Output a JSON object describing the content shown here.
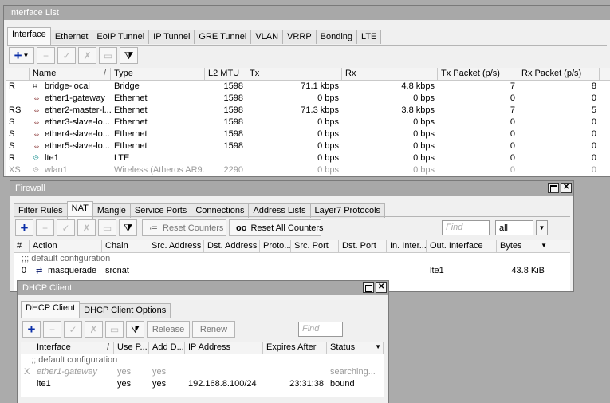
{
  "interface_window": {
    "title": "Interface List",
    "tabs": [
      "Interface",
      "Ethernet",
      "EoIP Tunnel",
      "IP Tunnel",
      "GRE Tunnel",
      "VLAN",
      "VRRP",
      "Bonding",
      "LTE"
    ],
    "columns": [
      "",
      "Name",
      "Type",
      "L2 MTU",
      "Tx",
      "Rx",
      "Tx Packet (p/s)",
      "Rx Packet (p/s)"
    ],
    "rows": [
      {
        "flag": "R",
        "name": "bridge-local",
        "type": "Bridge",
        "mtu": "1598",
        "tx": "71.1 kbps",
        "rx": "4.8 kbps",
        "txp": "7",
        "rxp": "8",
        "icon": "bridge-icon"
      },
      {
        "flag": "",
        "name": "ether1-gateway",
        "type": "Ethernet",
        "mtu": "1598",
        "tx": "0 bps",
        "rx": "0 bps",
        "txp": "0",
        "rxp": "0",
        "icon": "ethernet-icon"
      },
      {
        "flag": "RS",
        "name": "ether2-master-l...",
        "type": "Ethernet",
        "mtu": "1598",
        "tx": "71.3 kbps",
        "rx": "3.8 kbps",
        "txp": "7",
        "rxp": "5",
        "icon": "ethernet-icon"
      },
      {
        "flag": "S",
        "name": "ether3-slave-lo...",
        "type": "Ethernet",
        "mtu": "1598",
        "tx": "0 bps",
        "rx": "0 bps",
        "txp": "0",
        "rxp": "0",
        "icon": "ethernet-icon"
      },
      {
        "flag": "S",
        "name": "ether4-slave-lo...",
        "type": "Ethernet",
        "mtu": "1598",
        "tx": "0 bps",
        "rx": "0 bps",
        "txp": "0",
        "rxp": "0",
        "icon": "ethernet-icon"
      },
      {
        "flag": "S",
        "name": "ether5-slave-lo...",
        "type": "Ethernet",
        "mtu": "1598",
        "tx": "0 bps",
        "rx": "0 bps",
        "txp": "0",
        "rxp": "0",
        "icon": "ethernet-icon"
      },
      {
        "flag": "R",
        "name": "lte1",
        "type": "LTE",
        "mtu": "",
        "tx": "0 bps",
        "rx": "0 bps",
        "txp": "0",
        "rxp": "0",
        "icon": "lte-icon"
      },
      {
        "flag": "XS",
        "name": "wlan1",
        "type": "Wireless (Atheros AR9...",
        "mtu": "2290",
        "tx": "0 bps",
        "rx": "0 bps",
        "txp": "0",
        "rxp": "0",
        "icon": "wireless-icon",
        "disabled": true
      }
    ]
  },
  "firewall_window": {
    "title": "Firewall",
    "tabs": [
      "Filter Rules",
      "NAT",
      "Mangle",
      "Service Ports",
      "Connections",
      "Address Lists",
      "Layer7 Protocols"
    ],
    "reset_counters": "Reset Counters",
    "reset_all_counters": "Reset All Counters",
    "reset_all_prefix": "oo",
    "find_placeholder": "Find",
    "filter_value": "all",
    "columns": [
      "#",
      "Action",
      "Chain",
      "Src. Address",
      "Dst. Address",
      "Proto...",
      "Src. Port",
      "Dst. Port",
      "In. Inter...",
      "Out. Interface",
      "Bytes"
    ],
    "comment": ";;; default configuration",
    "rows": [
      {
        "num": "0",
        "action": "masquerade",
        "chain": "srcnat",
        "out_interface": "lte1",
        "bytes": "43.8 KiB"
      }
    ]
  },
  "dhcp_window": {
    "title": "DHCP Client",
    "tabs": [
      "DHCP Client",
      "DHCP Client Options"
    ],
    "release": "Release",
    "renew": "Renew",
    "find_placeholder": "Find",
    "columns": [
      "",
      "Interface",
      "Use P...",
      "Add D...",
      "IP Address",
      "Expires After",
      "Status"
    ],
    "comment": ";;; default configuration",
    "rows": [
      {
        "flag": "X",
        "interface": "ether1-gateway",
        "use_peer": "yes",
        "add_default": "yes",
        "ip": "",
        "expires": "",
        "status": "searching...",
        "disabled": true
      },
      {
        "flag": "",
        "interface": "lte1",
        "use_peer": "yes",
        "add_default": "yes",
        "ip": "192.168.8.100/24",
        "expires": "23:31:38",
        "status": "bound"
      }
    ]
  },
  "icons": {
    "add": "+",
    "remove": "−",
    "enable": "✓",
    "disable": "✗",
    "comment": "▭",
    "filter": "⧩",
    "sort": "/",
    "dropdown": "▼"
  },
  "colors": {
    "titlebar": "#a8a8a8",
    "add_icon": "#0a2ea8",
    "disabled_text": "#9b9b9b"
  }
}
